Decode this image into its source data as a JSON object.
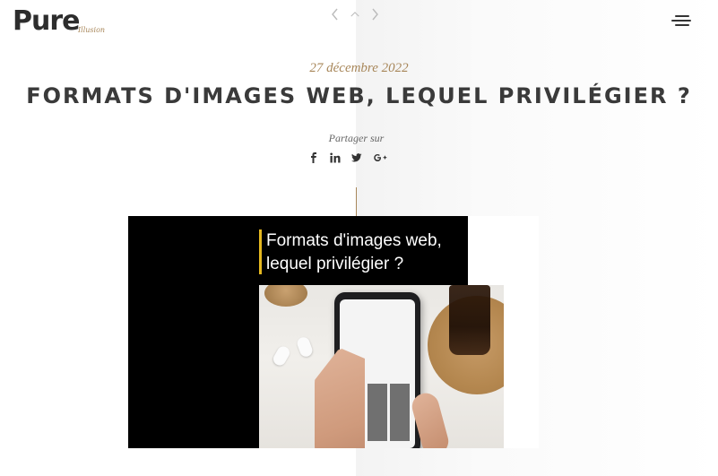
{
  "header": {
    "logo_main": "Pure",
    "logo_sub": "Illusion",
    "nav": {
      "prev_icon": "chevron-left-icon",
      "up_icon": "chevron-up-icon",
      "next_icon": "chevron-right-icon"
    },
    "menu_icon": "hamburger-menu-icon"
  },
  "post": {
    "date": "27 décembre 2022",
    "title": "FORMATS D'IMAGES WEB, LEQUEL PRIVILÉGIER ?",
    "share_label": "Partager sur",
    "share_icons": [
      {
        "name": "facebook-icon",
        "glyph": "f"
      },
      {
        "name": "linkedin-icon",
        "glyph": "in"
      },
      {
        "name": "twitter-icon",
        "glyph": "t"
      },
      {
        "name": "google-plus-icon",
        "glyph": "G+"
      }
    ]
  },
  "featured_image": {
    "title_line1": "Formats d'images web,",
    "title_line2": "lequel privilégier ?",
    "accent_color": "#e5b820"
  },
  "colors": {
    "accent_gold": "#a8875a",
    "text_dark": "#3a3a3a"
  }
}
